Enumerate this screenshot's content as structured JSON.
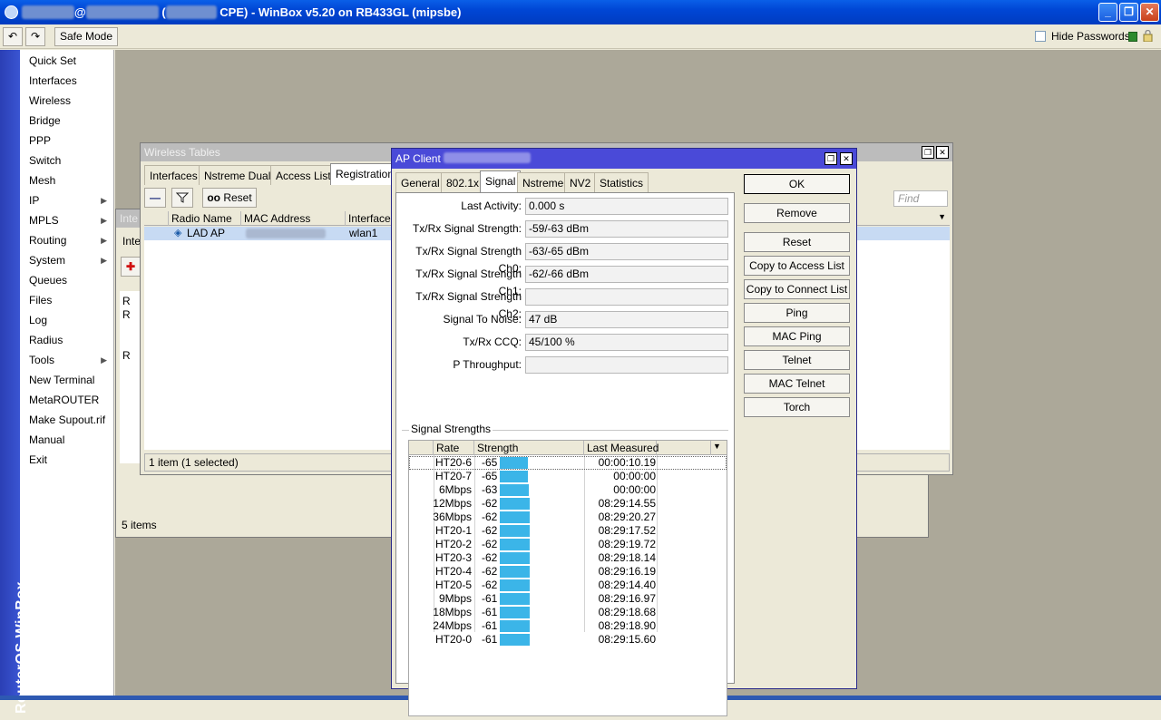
{
  "window": {
    "title_prefix": "@",
    "title_mid": "CPE) - WinBox v5.20 on RB433GL (mipsbe)",
    "title_open_paren": "(",
    "minimize": "_",
    "maximize": "❐",
    "close": "✕"
  },
  "toolbar": {
    "undo": "↶",
    "redo": "↷",
    "safe_mode": "Safe Mode",
    "hide_passwords": "Hide Passwords"
  },
  "brand": {
    "vertical": "RouterOS WinBox"
  },
  "menu": [
    {
      "label": "Quick Set",
      "arrow": ""
    },
    {
      "label": "Interfaces",
      "arrow": ""
    },
    {
      "label": "Wireless",
      "arrow": ""
    },
    {
      "label": "Bridge",
      "arrow": ""
    },
    {
      "label": "PPP",
      "arrow": ""
    },
    {
      "label": "Switch",
      "arrow": ""
    },
    {
      "label": "Mesh",
      "arrow": ""
    },
    {
      "label": "IP",
      "arrow": "▶"
    },
    {
      "label": "MPLS",
      "arrow": "▶"
    },
    {
      "label": "Routing",
      "arrow": "▶"
    },
    {
      "label": "System",
      "arrow": "▶"
    },
    {
      "label": "Queues",
      "arrow": ""
    },
    {
      "label": "Files",
      "arrow": ""
    },
    {
      "label": "Log",
      "arrow": ""
    },
    {
      "label": "Radius",
      "arrow": ""
    },
    {
      "label": "Tools",
      "arrow": "▶"
    },
    {
      "label": "New Terminal",
      "arrow": ""
    },
    {
      "label": "MetaROUTER",
      "arrow": ""
    },
    {
      "label": "Make Supout.rif",
      "arrow": ""
    },
    {
      "label": "Manual",
      "arrow": ""
    },
    {
      "label": "Exit",
      "arrow": ""
    }
  ],
  "interface_window": {
    "title": "Inte",
    "tab": "Inte",
    "add": "✚",
    "rows": [
      "R",
      "R",
      "R"
    ],
    "status": "5 items"
  },
  "wireless_tables": {
    "title": "Wireless Tables",
    "tabs": [
      "Interfaces",
      "Nstreme Dual",
      "Access List",
      "Registration"
    ],
    "remove": "—",
    "filter": "⊤",
    "reset_prefix": "oo",
    "reset": "Reset",
    "find": "Find",
    "columns": [
      "Radio Name",
      "MAC Address",
      "Interface"
    ],
    "rows": [
      {
        "radio_name": "LAD AP",
        "mac": "",
        "interface": "wlan1"
      }
    ],
    "status": "1 item (1 selected)"
  },
  "ap_client": {
    "title": "AP Client",
    "tabs": [
      "General",
      "802.1x",
      "Signal",
      "Nstreme",
      "NV2",
      "Statistics"
    ],
    "fields": [
      {
        "label": "Last Activity:",
        "value": "0.000 s"
      },
      {
        "label": "Tx/Rx Signal Strength:",
        "value": "-59/-63 dBm"
      },
      {
        "label": "Tx/Rx Signal Strength Ch0:",
        "value": "-63/-65 dBm"
      },
      {
        "label": "Tx/Rx Signal Strength Ch1:",
        "value": "-62/-66 dBm"
      },
      {
        "label": "Tx/Rx Signal Strength Ch2:",
        "value": ""
      },
      {
        "label": "Signal To Noise:",
        "value": "47 dB"
      },
      {
        "label": "Tx/Rx CCQ:",
        "value": "45/100 %"
      },
      {
        "label": "P Throughput:",
        "value": ""
      }
    ],
    "signal_group": "Signal Strengths",
    "columns": [
      "Rate",
      "Strength",
      "Last Measured"
    ],
    "signal_rows": [
      {
        "rate": "HT20-6",
        "strength": "-65",
        "level": 0.65,
        "measured": "00:00:10.19"
      },
      {
        "rate": "HT20-7",
        "strength": "-65",
        "level": 0.65,
        "measured": "00:00:00"
      },
      {
        "rate": "6Mbps",
        "strength": "-63",
        "level": 0.66,
        "measured": "00:00:00"
      },
      {
        "rate": "12Mbps",
        "strength": "-62",
        "level": 0.68,
        "measured": "08:29:14.55"
      },
      {
        "rate": "36Mbps",
        "strength": "-62",
        "level": 0.68,
        "measured": "08:29:20.27"
      },
      {
        "rate": "HT20-1",
        "strength": "-62",
        "level": 0.68,
        "measured": "08:29:17.52"
      },
      {
        "rate": "HT20-2",
        "strength": "-62",
        "level": 0.68,
        "measured": "08:29:19.72"
      },
      {
        "rate": "HT20-3",
        "strength": "-62",
        "level": 0.68,
        "measured": "08:29:18.14"
      },
      {
        "rate": "HT20-4",
        "strength": "-62",
        "level": 0.68,
        "measured": "08:29:16.19"
      },
      {
        "rate": "HT20-5",
        "strength": "-62",
        "level": 0.68,
        "measured": "08:29:14.40"
      },
      {
        "rate": "9Mbps",
        "strength": "-61",
        "level": 0.69,
        "measured": "08:29:16.97"
      },
      {
        "rate": "18Mbps",
        "strength": "-61",
        "level": 0.69,
        "measured": "08:29:18.68"
      },
      {
        "rate": "24Mbps",
        "strength": "-61",
        "level": 0.69,
        "measured": "08:29:18.90"
      },
      {
        "rate": "HT20-0",
        "strength": "-61",
        "level": 0.69,
        "measured": "08:29:15.60"
      }
    ],
    "buttons": [
      "OK",
      "Remove",
      "Reset",
      "Copy to Access List",
      "Copy to Connect List",
      "Ping",
      "MAC Ping",
      "Telnet",
      "MAC Telnet",
      "Torch"
    ]
  },
  "colors": {
    "accent": "#0046d5",
    "bar": "#3bb5e8",
    "desktop": "#aca899",
    "dialog_title": "#4a4ad8"
  }
}
